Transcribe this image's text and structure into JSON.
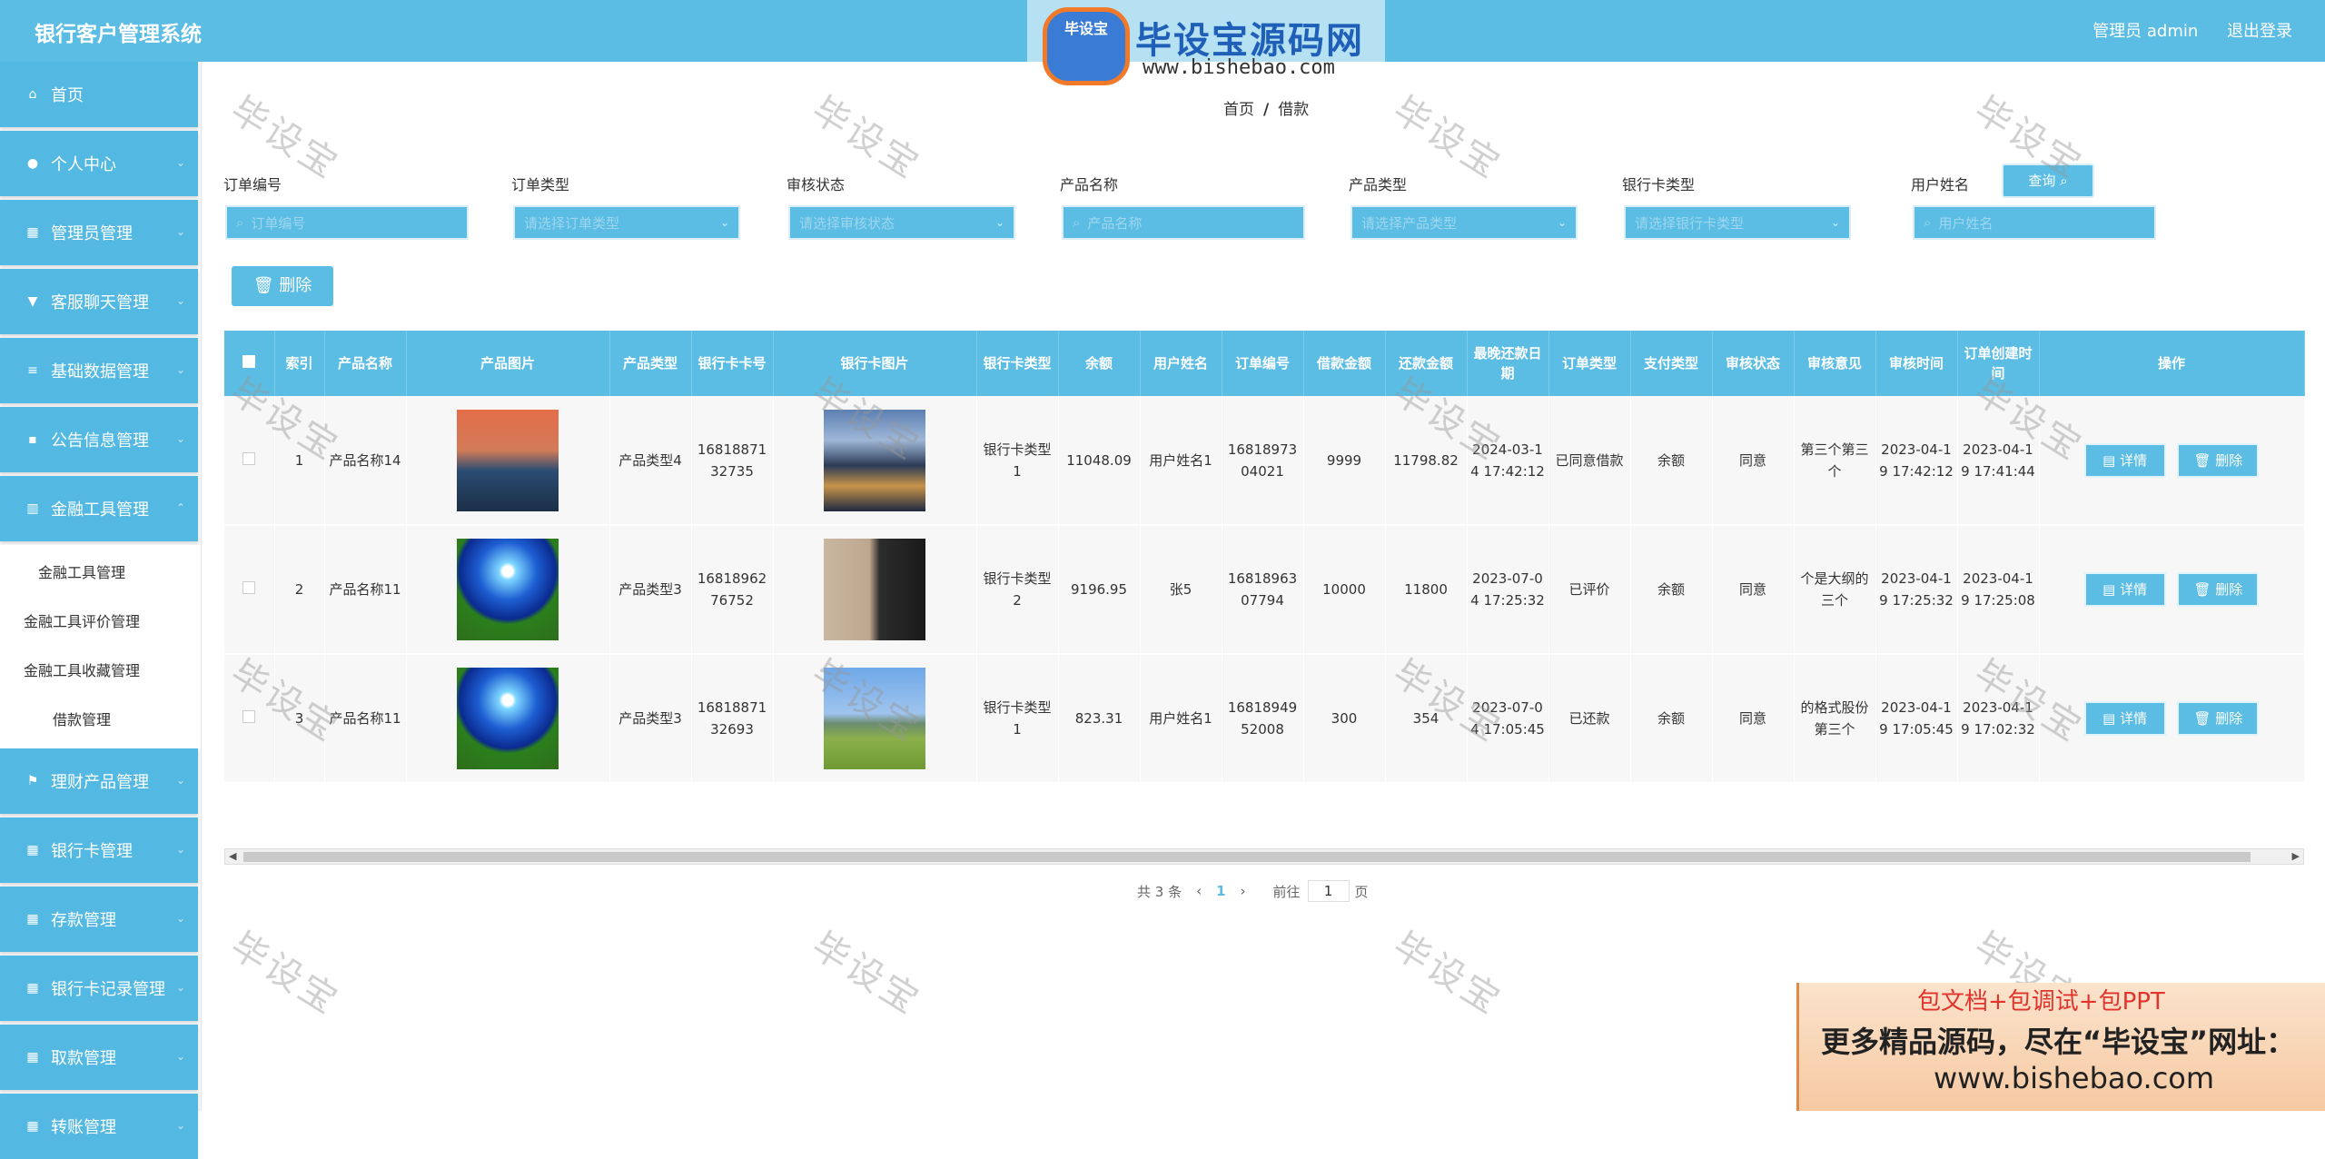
{
  "header": {
    "title": "银行客户管理系统",
    "user_label": "管理员 admin",
    "logout_label": "退出登录"
  },
  "overlay": {
    "logo_badge": "毕设宝",
    "logo_title": "毕设宝源码网",
    "logo_url": "www.bishebao.com",
    "watermark": "毕设宝",
    "promo_line1": "包文档+包调试+包PPT",
    "promo_line2": "更多精品源码，尽在“毕设宝”网址：",
    "promo_line3": "www.bishebao.com"
  },
  "sidebar": {
    "items": [
      {
        "label": "首页",
        "icon": "home-icon"
      },
      {
        "label": "个人中心",
        "icon": "user-icon"
      },
      {
        "label": "管理员管理",
        "icon": "grid-icon"
      },
      {
        "label": "客服聊天管理",
        "icon": "chat-icon"
      },
      {
        "label": "基础数据管理",
        "icon": "list-icon"
      },
      {
        "label": "公告信息管理",
        "icon": "message-icon"
      },
      {
        "label": "金融工具管理",
        "icon": "bar-chart-icon"
      },
      {
        "label": "理财产品管理",
        "icon": "flag-icon"
      },
      {
        "label": "银行卡管理",
        "icon": "grid-icon"
      },
      {
        "label": "存款管理",
        "icon": "grid-icon"
      },
      {
        "label": "银行卡记录管理",
        "icon": "grid-icon"
      },
      {
        "label": "取款管理",
        "icon": "grid-icon"
      },
      {
        "label": "转账管理",
        "icon": "grid-icon"
      }
    ],
    "submenu": [
      "金融工具管理",
      "金融工具评价管理",
      "金融工具收藏管理",
      "借款管理"
    ]
  },
  "breadcrumb": {
    "home": "首页",
    "separator": "/",
    "current": "借款"
  },
  "filters": [
    {
      "label": "订单编号",
      "placeholder": "订单编号",
      "type": "input"
    },
    {
      "label": "订单类型",
      "placeholder": "请选择订单类型",
      "type": "select"
    },
    {
      "label": "审核状态",
      "placeholder": "请选择审核状态",
      "type": "select"
    },
    {
      "label": "产品名称",
      "placeholder": "产品名称",
      "type": "input"
    },
    {
      "label": "产品类型",
      "placeholder": "请选择产品类型",
      "type": "select"
    },
    {
      "label": "银行卡类型",
      "placeholder": "请选择银行卡类型",
      "type": "select"
    },
    {
      "label": "用户姓名",
      "placeholder": "用户姓名",
      "type": "input"
    }
  ],
  "toolbar": {
    "query_label": "查询",
    "delete_label": "删除"
  },
  "table": {
    "columns": [
      "",
      "索引",
      "产品名称",
      "产品图片",
      "产品类型",
      "银行卡卡号",
      "银行卡图片",
      "银行卡类型",
      "余额",
      "用户姓名",
      "订单编号",
      "借款金额",
      "还款金额",
      "最晚还款日期",
      "订单类型",
      "支付类型",
      "审核状态",
      "审核意见",
      "审核时间",
      "订单创建时间",
      "操作"
    ],
    "rows": [
      {
        "index": "1",
        "product_name": "产品名称14",
        "product_image": "sunset",
        "product_type": "产品类型4",
        "card_no": "1681887132735",
        "card_image": "city",
        "card_type": "银行卡类型1",
        "balance": "11048.09",
        "user_name": "用户姓名1",
        "order_no": "1681897304021",
        "loan": "9999",
        "repay": "11798.82",
        "due_date": "2024-03-14 17:42:12",
        "order_type": "已同意借款",
        "pay_type": "余额",
        "audit_status": "同意",
        "audit_opinion": "第三个第三个",
        "audit_time": "2023-04-19 17:42:12",
        "create_time": "2023-04-19 17:41:44"
      },
      {
        "index": "2",
        "product_name": "产品名称11",
        "product_image": "meadow",
        "product_type": "产品类型3",
        "card_no": "1681896276752",
        "card_image": "portrait",
        "card_type": "银行卡类型2",
        "balance": "9196.95",
        "user_name": "张5",
        "order_no": "1681896307794",
        "loan": "10000",
        "repay": "11800",
        "due_date": "2023-07-04 17:25:32",
        "order_type": "已评价",
        "pay_type": "余额",
        "audit_status": "同意",
        "audit_opinion": "个是大纲的三个",
        "audit_time": "2023-04-19 17:25:32",
        "create_time": "2023-04-19 17:25:08"
      },
      {
        "index": "3",
        "product_name": "产品名称11",
        "product_image": "meadow",
        "product_type": "产品类型3",
        "card_no": "1681887132693",
        "card_image": "hill",
        "card_type": "银行卡类型1",
        "balance": "823.31",
        "user_name": "用户姓名1",
        "order_no": "1681894952008",
        "loan": "300",
        "repay": "354",
        "due_date": "2023-07-04 17:05:45",
        "order_type": "已还款",
        "pay_type": "余额",
        "audit_status": "同意",
        "audit_opinion": "的格式股份第三个",
        "audit_time": "2023-04-19 17:05:45",
        "create_time": "2023-04-19 17:02:32"
      }
    ],
    "detail_label": "详情",
    "delete_label": "删除"
  },
  "pagination": {
    "total": "共 3 条",
    "current_page": "1",
    "goto_label": "前往",
    "goto_value": "1",
    "page_unit": "页"
  }
}
